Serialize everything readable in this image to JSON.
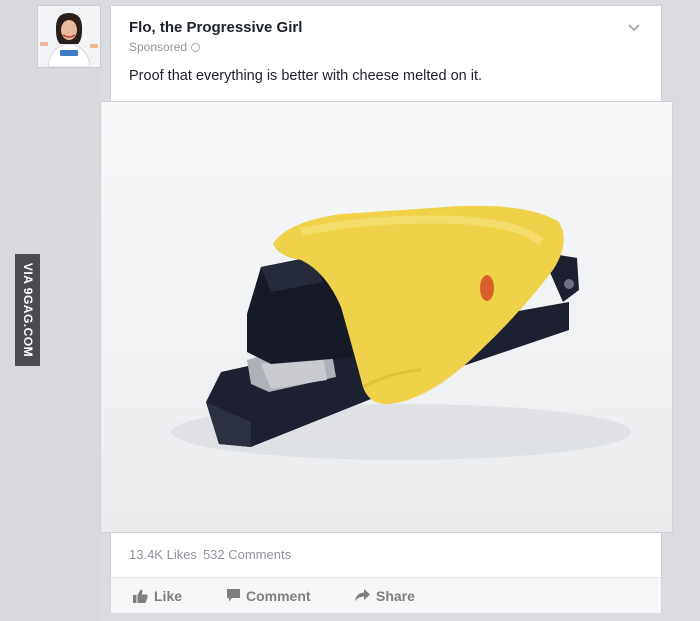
{
  "post": {
    "page_name": "Flo, the Progressive Girl",
    "sponsored_label": "Sponsored",
    "text": "Proof that everything is better with cheese melted on it.",
    "likes": "13.4K Likes",
    "comments": "532 Comments"
  },
  "actions": {
    "like": "Like",
    "comment": "Comment",
    "share": "Share"
  },
  "watermark": "VIA 9GAG.COM",
  "icons": {
    "menu": "chevron-down-icon",
    "audience": "globe-icon",
    "like": "thumbs-up-icon",
    "comment": "speech-bubble-icon",
    "share": "share-arrow-icon"
  },
  "colors": {
    "background": "#d9dbde",
    "name": "#1d2129",
    "meta": "#90949c",
    "cheese": "#f0d448",
    "stapler": "#1f2330"
  }
}
